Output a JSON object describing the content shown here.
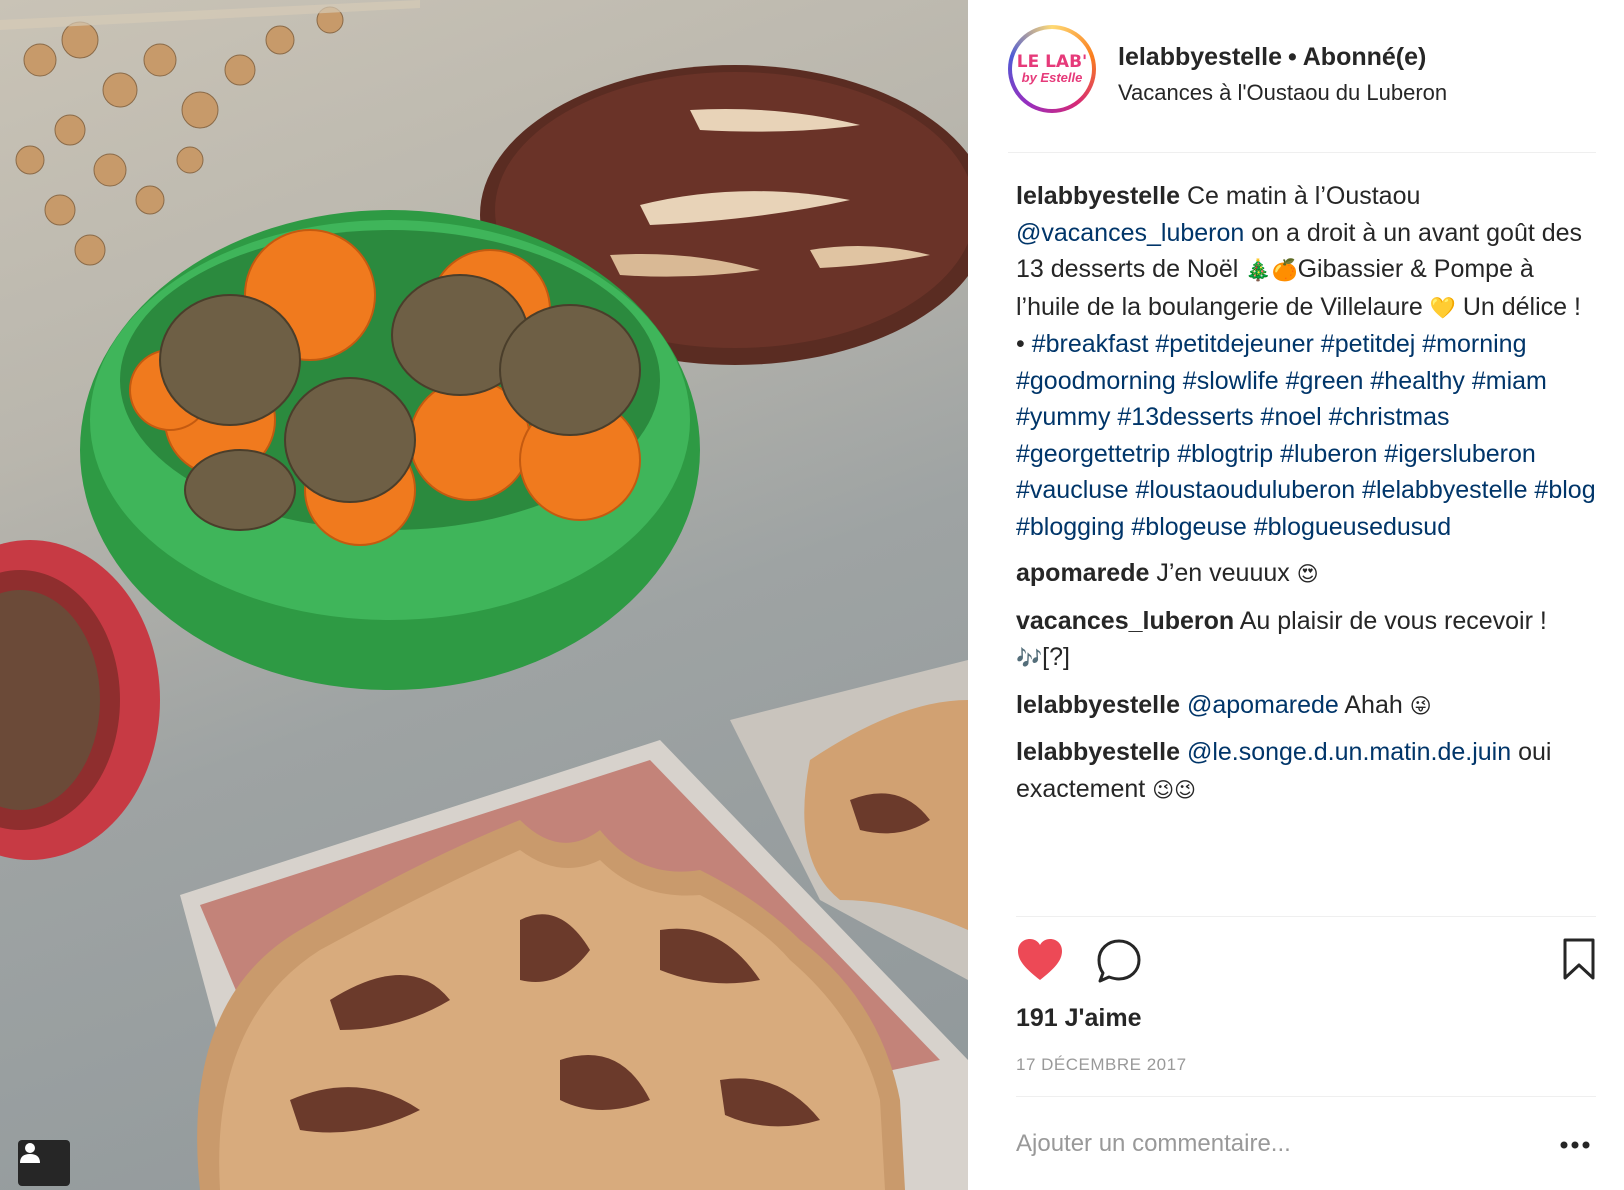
{
  "post": {
    "username": "lelabbyestelle",
    "separator": "•",
    "follow_state": "Abonné(e)",
    "location": "Vacances à l'Oustaou du Luberon",
    "logo": {
      "top": "LE LAB'",
      "bottom": "by Estelle"
    },
    "caption": {
      "author": "lelabbyestelle",
      "text_1": "Ce matin à l’Oustaou",
      "mention": "@vacances_luberon",
      "text_2": "on a droit à un avant goût des 13 desserts de Noël",
      "emoji_1": "🎄🍊",
      "text_3": "Gibassier & Pompe à l’huile de la boulangerie de Villelaure",
      "emoji_2": "💛",
      "text_4": "Un délice ! •",
      "hashtags": "#breakfast #petitdejeuner #petitdej #morning #goodmorning #slowlife #green #healthy #miam #yummy #13desserts #noel #christmas #georgettetrip #blogtrip #luberon #igersluberon #vaucluse #loustaouduluberon #lelabbyestelle #blog #blogging #blogeuse #blogueusedusud"
    },
    "comments": [
      {
        "user": "apomarede",
        "text": "J’en veuuux",
        "emoji": "😍"
      },
      {
        "user": "vacances_luberon",
        "text": "Au plaisir de vous recevoir !",
        "emoji": "🎶",
        "extra": "[?]"
      },
      {
        "user": "lelabbyestelle",
        "mention": "@apomarede",
        "text": "Ahah",
        "emoji": "😜"
      },
      {
        "user": "lelabbyestelle",
        "mention": "@le.songe.d.un.matin.de.juin",
        "text": "oui exactement",
        "emoji": "😉😉"
      }
    ],
    "likes": "191 J'aime",
    "date": "17 DÉCEMBRE 2017",
    "comment_placeholder": "Ajouter un commentaire...",
    "more_label": "•••",
    "liked": true,
    "colors": {
      "heart": "#ed4956",
      "link": "#003569",
      "muted": "#999999",
      "brand": "#e63a7a"
    },
    "icons": [
      "heart-icon",
      "comment-icon",
      "bookmark-icon",
      "user-tag-icon",
      "more-icon"
    ]
  }
}
